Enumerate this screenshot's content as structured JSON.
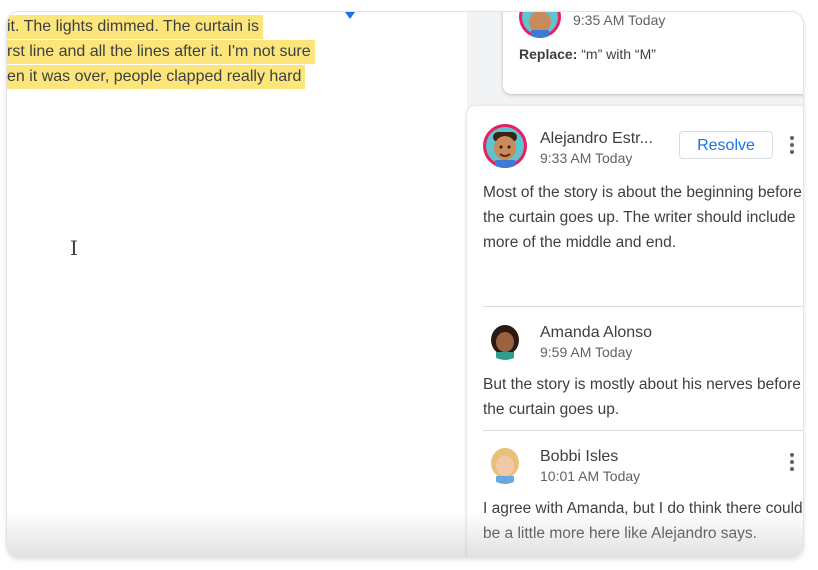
{
  "document": {
    "lines": [
      "it. The lights dimmed. The curtain is",
      "rst line and all the lines after it. I'm not sure",
      "en it was over, people clapped really hard"
    ]
  },
  "suggestion": {
    "time": "9:35 AM Today",
    "replace_label": "Replace:",
    "replace_text": "“m” with “M”"
  },
  "thread": {
    "resolve_label": "Resolve",
    "comments": [
      {
        "author": "Alejandro Estr...",
        "time": "9:33 AM Today",
        "text": "Most of the story is about the beginning before the curtain goes up. The writer should include more of the middle and end."
      },
      {
        "author": "Amanda Alonso",
        "time": "9:59 AM Today",
        "text": "But the story is mostly about his nerves before the curtain goes up."
      },
      {
        "author": "Bobbi Isles",
        "time": "10:01 AM Today",
        "text": "I agree with Amanda, but I do think there could be a little more here like Alejandro says."
      }
    ]
  },
  "colors": {
    "highlight": "#fce57a",
    "accent": "#1a73e8",
    "avatar_ring": "#e91e63"
  }
}
